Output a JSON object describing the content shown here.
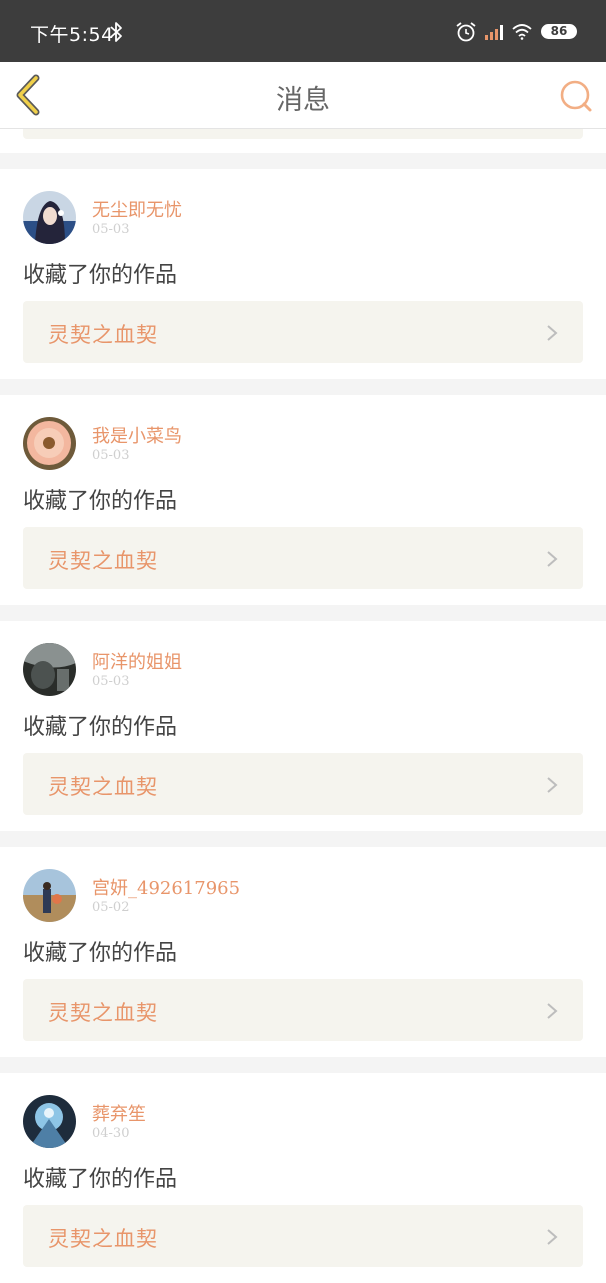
{
  "status_bar": {
    "time": "下午5:54",
    "battery": "86"
  },
  "nav": {
    "title": "消息"
  },
  "colors": {
    "accent": "#e8956a",
    "link_bg": "#f5f4ee",
    "status_bar_bg": "#3d3d3d"
  },
  "icons": [
    "bluetooth-icon",
    "alarm-icon",
    "signal-icon",
    "wifi-icon",
    "back-icon",
    "search-icon",
    "chevron-right-icon"
  ],
  "messages": [
    {
      "name": "无尘即无忧",
      "date": "05-03",
      "action": "收藏了你的作品",
      "work": "灵契之血契"
    },
    {
      "name": "我是小菜鸟",
      "date": "05-03",
      "action": "收藏了你的作品",
      "work": "灵契之血契"
    },
    {
      "name": "阿洋的姐姐",
      "date": "05-03",
      "action": "收藏了你的作品",
      "work": "灵契之血契"
    },
    {
      "name": "宫妍_492617965",
      "date": "05-02",
      "action": "收藏了你的作品",
      "work": "灵契之血契"
    },
    {
      "name": "葬弃笙",
      "date": "04-30",
      "action": "收藏了你的作品",
      "work": "灵契之血契"
    }
  ]
}
